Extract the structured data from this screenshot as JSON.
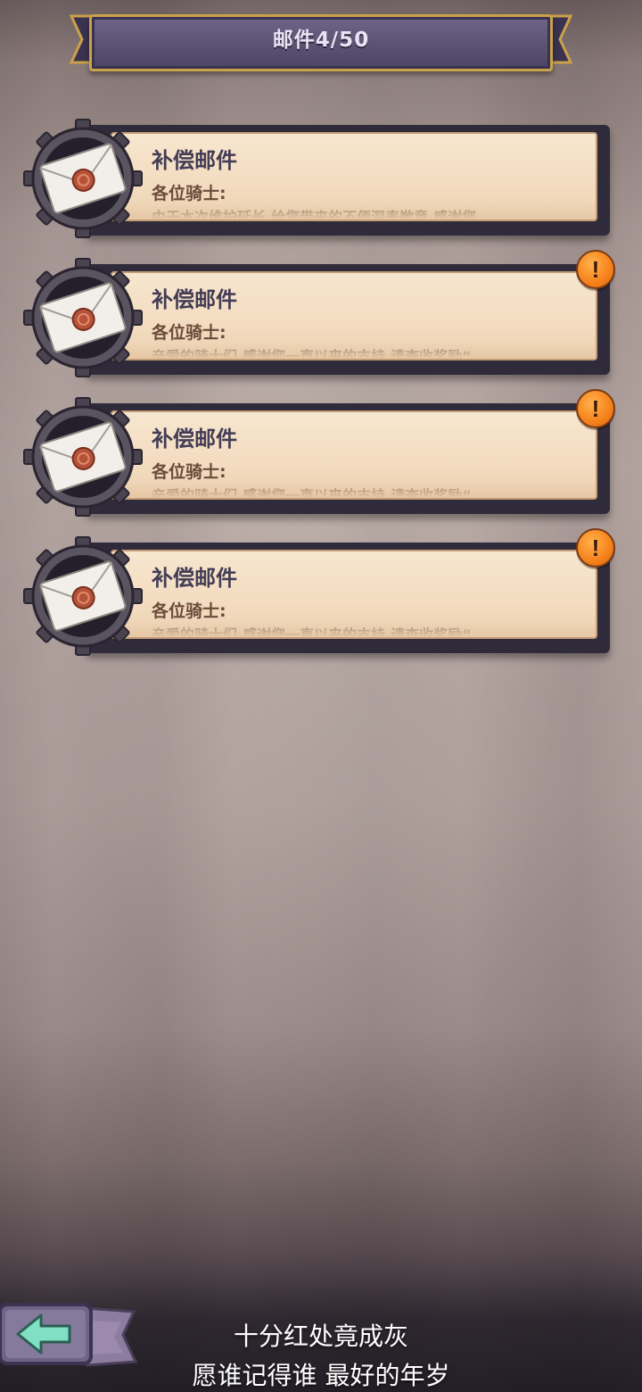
{
  "header": {
    "title": "邮件4/50"
  },
  "mails": [
    {
      "icon": "sealed-envelope-icon",
      "title": "补偿邮件",
      "greeting": "各位骑士:",
      "preview": "由于本次维护延长,给您带来的不便深表歉意,感谢您",
      "unread": false
    },
    {
      "icon": "sealed-envelope-icon",
      "title": "补偿邮件",
      "greeting": "各位骑士:",
      "preview": "亲爱的骑士们,感谢您一直以来的支持,请查收奖励“",
      "unread": true,
      "badge": "!"
    },
    {
      "icon": "sealed-envelope-icon",
      "title": "补偿邮件",
      "greeting": "各位骑士:",
      "preview": "亲爱的骑士们,感谢您一直以来的支持,请查收奖励“",
      "unread": true,
      "badge": "!"
    },
    {
      "icon": "sealed-envelope-icon",
      "title": "补偿邮件",
      "greeting": "各位骑士:",
      "preview": "亲爱的骑士们,感谢您一直以来的支持,请查收奖励“",
      "unread": true,
      "badge": "!"
    }
  ],
  "footer": {
    "back_icon": "arrow-left-icon",
    "lyric_line1": "十分红处竟成灰",
    "lyric_line2": "愿谁记得谁 最好的年岁"
  },
  "colors": {
    "banner": "#5b5274",
    "banner_border": "#c9a24a",
    "paper": "#f3dcc0",
    "mail_title": "#433d55",
    "greeting": "#6b4a3a",
    "badge": "#f7851e",
    "back_arrow": "#7fe0c4"
  }
}
